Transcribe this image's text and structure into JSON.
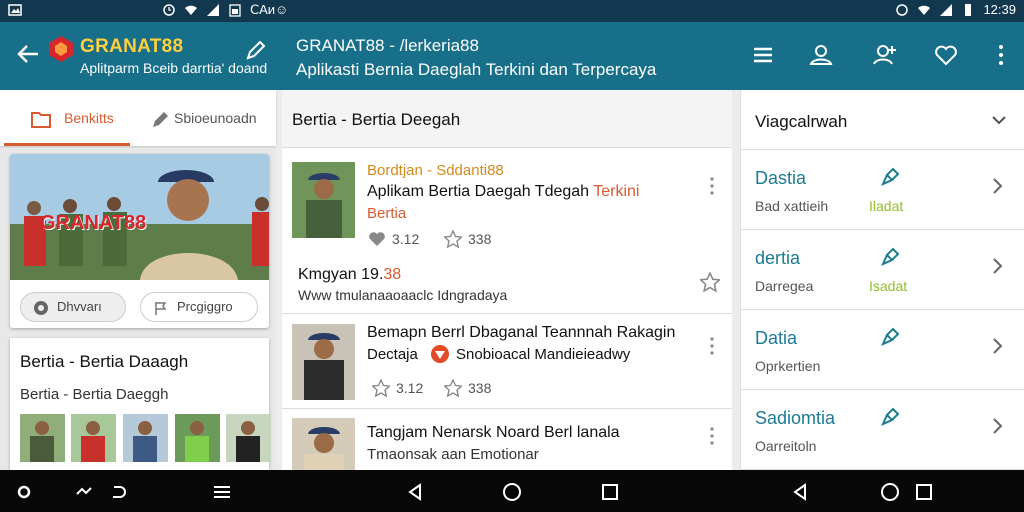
{
  "status_bar": {
    "left_text": "ⅭAᴎ☺",
    "time": "12:39"
  },
  "app_bar": {
    "brand": "GRANAT88",
    "brand_subtitle": "Aplitparm Bceib darrtia' doand",
    "title": "GRANAT88 - /lerkeria88",
    "subtitle": "Aplikasti Bernia Daeglah Terkini dan Terpercaya"
  },
  "left_tabs": [
    {
      "label": "Benkitts",
      "icon": "folder-icon"
    },
    {
      "label": "Sbioeunoadn",
      "icon": "pen-icon"
    }
  ],
  "hero": {
    "overlay_text": "GRANAT88",
    "chips": [
      {
        "label": "Dhvvarı"
      },
      {
        "label": "Prcgiggro"
      }
    ]
  },
  "info_card": {
    "title": "Bertia - Bertia Daaagh",
    "subtitle": "Bertia - Bertia Daeggh"
  },
  "middle": {
    "header": "Bertia - Bertia Deegah",
    "items": [
      {
        "source": "Bordtjan - Sddanti88",
        "title_line1": "Aplikam Bertia Daegah Tdegah",
        "title_line1_suffix": "Terkini",
        "title_line2": "Bertia",
        "likes": "3.12",
        "stars": "338"
      },
      {
        "title": "Kmgyan 19.",
        "title_suffix": "38",
        "subtitle": "Www tmulanaaoaaclc Idngradaya"
      },
      {
        "title": "Bemapn Berrl Dbaganal Teannnah Rakagin",
        "source": "Dectaja",
        "publisher": "Snobioacal Mandieieadwy",
        "likes": "3.12",
        "stars": "338"
      },
      {
        "title": "Tangjam Nenarsk Noard Berl lanala",
        "subtitle": "Tmaonsak aan Emotionar"
      }
    ]
  },
  "right": {
    "header": "Viagcalrwah",
    "rows": [
      {
        "title": "Dastia",
        "subtitle": "Bad xattieih",
        "tag": "Iladat"
      },
      {
        "title": "dertia",
        "subtitle": "Darregea",
        "tag": "Isadat"
      },
      {
        "title": "Datia",
        "subtitle": "Oprkertien",
        "tag": ""
      },
      {
        "title": "Sadiomtia",
        "subtitle": "Oarreitoln",
        "tag": ""
      }
    ]
  },
  "colors": {
    "appbar": "#176f8a",
    "status": "#12384f",
    "accent": "#d85a2f",
    "teal_text": "#1b7b93",
    "brand_yellow": "#ffcf3c"
  }
}
